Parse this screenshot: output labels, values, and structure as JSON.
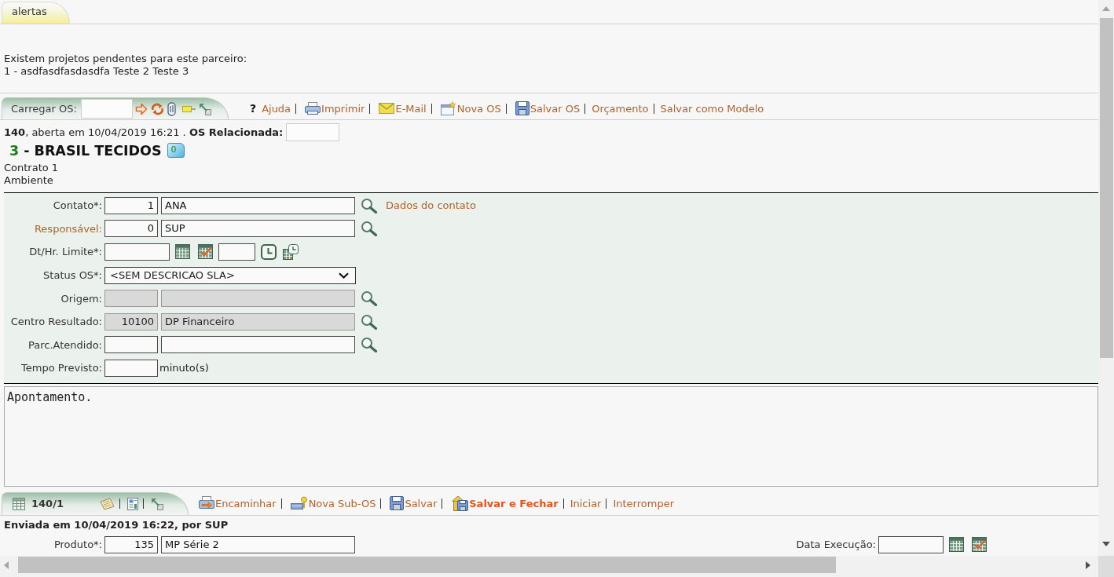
{
  "alerts_tab": {
    "label": "alertas"
  },
  "alert": {
    "lines": [
      "Existem projetos pendentes para este parceiro:",
      "1 - asdfasdfasdasdfa Teste 2 Teste 3"
    ]
  },
  "os_toolbar": {
    "load_label": "Carregar OS:",
    "actions": [
      {
        "kind": "help",
        "glyph": "?",
        "label": "Ajuda"
      },
      {
        "kind": "print",
        "label": "Imprimir"
      },
      {
        "kind": "mail",
        "label": "E-Mail"
      },
      {
        "kind": "new",
        "label": "Nova OS"
      },
      {
        "kind": "save",
        "label": "Salvar OS"
      },
      {
        "kind": "plain",
        "label": "Orçamento"
      },
      {
        "kind": "plain",
        "label": "Salvar como Modelo"
      }
    ]
  },
  "os_header": {
    "summary": "**140**, aberta em 10/04/2019 16:21 . **OS Relacionada:**",
    "partner_code": "3",
    "partner_name": "- BRASIL TECIDOS",
    "notes_count": "0",
    "details": [
      "Contrato 1",
      "Ambiente"
    ]
  },
  "form": {
    "rows": [
      {
        "kind": "lookup",
        "label": "Contato*:",
        "label_link": false,
        "disabled": false,
        "code": "1",
        "value": "ANA",
        "link": "Dados do contato"
      },
      {
        "kind": "lookup",
        "label": "Responsável:",
        "label_link": true,
        "disabled": false,
        "code": "0",
        "value": "SUP"
      },
      {
        "kind": "datetime",
        "label": "Dt/Hr. Limite*:",
        "label_link": false,
        "disabled": false
      },
      {
        "kind": "select",
        "label": "Status OS*:",
        "label_link": false,
        "disabled": false,
        "value": "<SEM DESCRICAO SLA>"
      },
      {
        "kind": "lookup",
        "label": "Origem:",
        "label_link": false,
        "disabled": true
      },
      {
        "kind": "lookup",
        "label": "Centro Resultado:",
        "label_link": false,
        "disabled": true,
        "code": "10100",
        "value": "DP Financeiro"
      },
      {
        "kind": "lookup",
        "label": "Parc.Atendido:",
        "label_link": false,
        "disabled": false
      },
      {
        "kind": "duration",
        "label": "Tempo Previsto:",
        "label_link": false,
        "disabled": false,
        "unit": "minuto(s)"
      }
    ]
  },
  "notes": {
    "value": "Apontamento."
  },
  "sub_os": {
    "title": "140/1",
    "actions": [
      {
        "kind": "forward",
        "label": "Encaminhar",
        "emphasis": false
      },
      {
        "kind": "new-sub",
        "label": "Nova Sub-OS",
        "emphasis": false
      },
      {
        "kind": "save",
        "label": "Salvar",
        "emphasis": false
      },
      {
        "kind": "save-close",
        "label": "Salvar e Fechar",
        "emphasis": true
      },
      {
        "kind": "plain",
        "label": "Iniciar",
        "emphasis": false
      },
      {
        "kind": "plain",
        "label": "Interromper",
        "emphasis": false
      }
    ],
    "sent": "Enviada em 10/04/2019 16:22, por SUP",
    "product": {
      "label": "Produto*:",
      "code": "135",
      "value": "MP Série 2"
    },
    "execution_date": {
      "label": "Data Execução:"
    }
  }
}
